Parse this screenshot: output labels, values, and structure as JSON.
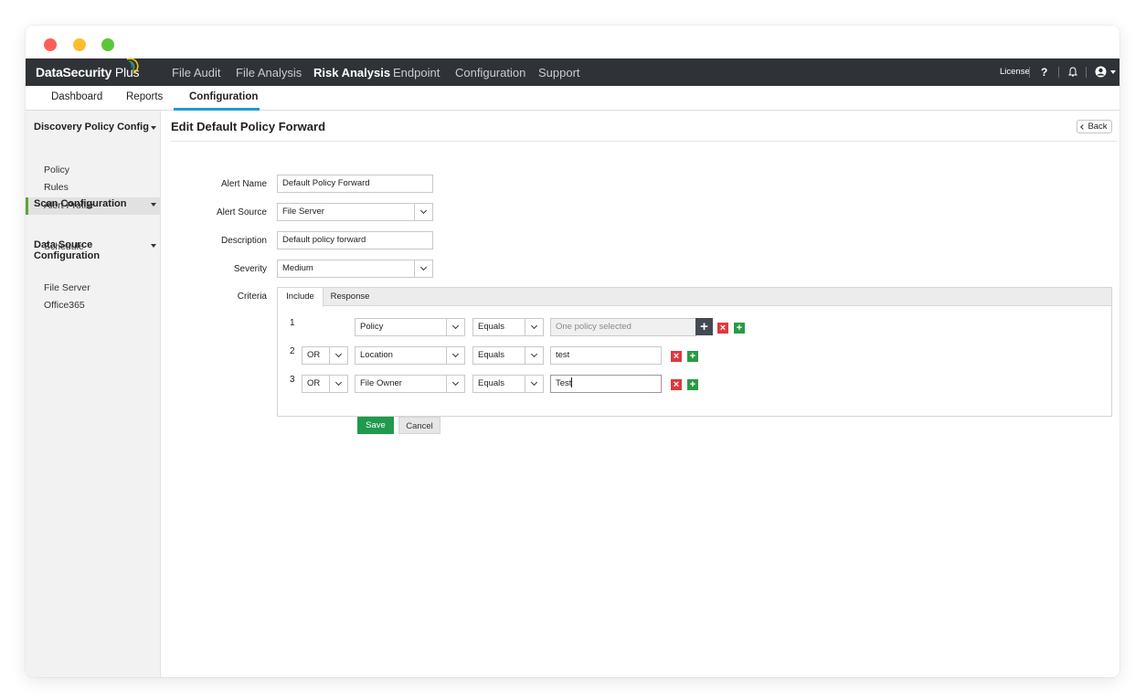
{
  "app": {
    "logo_text": "DataSecurity",
    "logo_plus": "Plus",
    "nav": [
      "File Audit",
      "File Analysis",
      "Risk Analysis",
      "Endpoint",
      "Configuration",
      "Support"
    ],
    "active_nav": "Risk Analysis",
    "license": "License",
    "help": "?"
  },
  "subnav": {
    "items": [
      "Dashboard",
      "Reports",
      "Configuration"
    ],
    "active": "Configuration"
  },
  "sidebar": {
    "groups": [
      {
        "label": "Discovery Policy Config",
        "items": [
          "Policy",
          "Rules",
          "Alert Profile"
        ]
      },
      {
        "label": "Scan Configuration",
        "items": [
          "Schedule"
        ]
      },
      {
        "label": "Data Source Configuration",
        "items": [
          "File Server",
          "Office365"
        ]
      }
    ],
    "active_item": "Alert Profile"
  },
  "page": {
    "title": "Edit Default Policy Forward",
    "back": "Back"
  },
  "form": {
    "alert_name_label": "Alert Name",
    "alert_name_value": "Default Policy Forward",
    "alert_source_label": "Alert Source",
    "alert_source_value": "File Server",
    "description_label": "Description",
    "description_value": "Default policy forward",
    "severity_label": "Severity",
    "severity_value": "Medium",
    "criteria_label": "Criteria"
  },
  "criteria": {
    "tabs": [
      "Include",
      "Response"
    ],
    "active_tab": "Include",
    "rows": [
      {
        "num": "1",
        "join": "",
        "field": "Policy",
        "op": "Equals",
        "value": "",
        "value_placeholder": "One policy selected"
      },
      {
        "num": "2",
        "join": "OR",
        "field": "Location",
        "op": "Equals",
        "value": "test",
        "value_placeholder": ""
      },
      {
        "num": "3",
        "join": "OR",
        "field": "File Owner",
        "op": "Equals",
        "value": "Test",
        "value_placeholder": ""
      }
    ]
  },
  "actions": {
    "save": "Save",
    "cancel": "Cancel"
  },
  "colors": {
    "nav_bg": "#2f3237",
    "accent_blue": "#1f9bd1",
    "accent_green": "#1f9a4f",
    "delete_red": "#e0383e"
  }
}
